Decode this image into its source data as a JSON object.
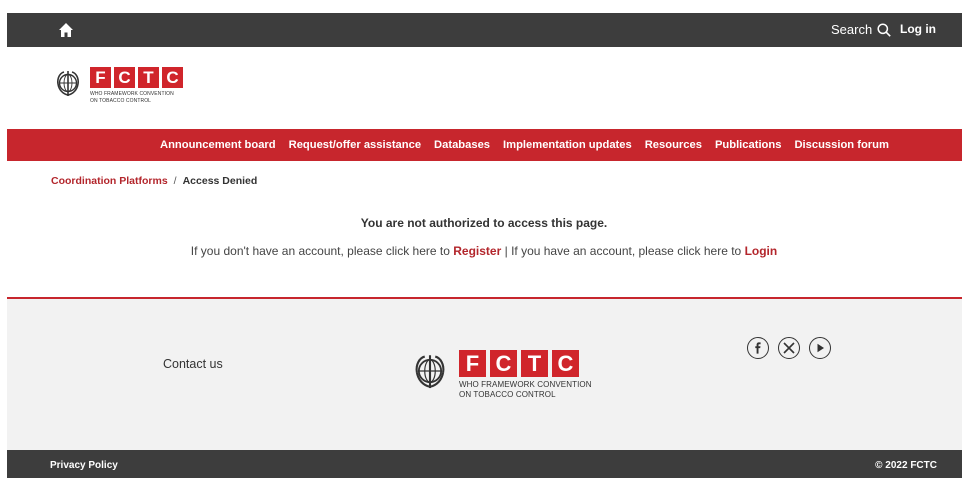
{
  "topbar": {
    "home_icon": "home-icon",
    "search_label": "Search",
    "search_icon": "search-icon",
    "login_label": "Log in"
  },
  "logo": {
    "letters": [
      "F",
      "C",
      "T",
      "C"
    ],
    "tagline_line1": "WHO FRAMEWORK CONVENTION",
    "tagline_line2": "ON TOBACCO CONTROL",
    "brand_color": "#d0252b"
  },
  "nav": {
    "items": [
      {
        "label": "Announcement board"
      },
      {
        "label": "Request/offer assistance"
      },
      {
        "label": "Databases"
      },
      {
        "label": "Implementation updates"
      },
      {
        "label": "Resources"
      },
      {
        "label": "Publications"
      },
      {
        "label": "Discussion forum"
      }
    ],
    "bg_color": "#c7262d"
  },
  "breadcrumb": {
    "parent": "Coordination Platforms",
    "separator": "/",
    "current": "Access Denied"
  },
  "main": {
    "title": "You are not authorized to access this page.",
    "msg_part1": "If you don't have an account, please click here to",
    "register_link": "Register",
    "msg_part2": "| If you have an account, please click here to",
    "login_link": "Login"
  },
  "footer": {
    "contact_label": "Contact us",
    "socials": [
      "facebook-icon",
      "x-icon",
      "youtube-icon"
    ],
    "privacy_label": "Privacy Policy",
    "copyright": "© 2022 FCTC"
  }
}
